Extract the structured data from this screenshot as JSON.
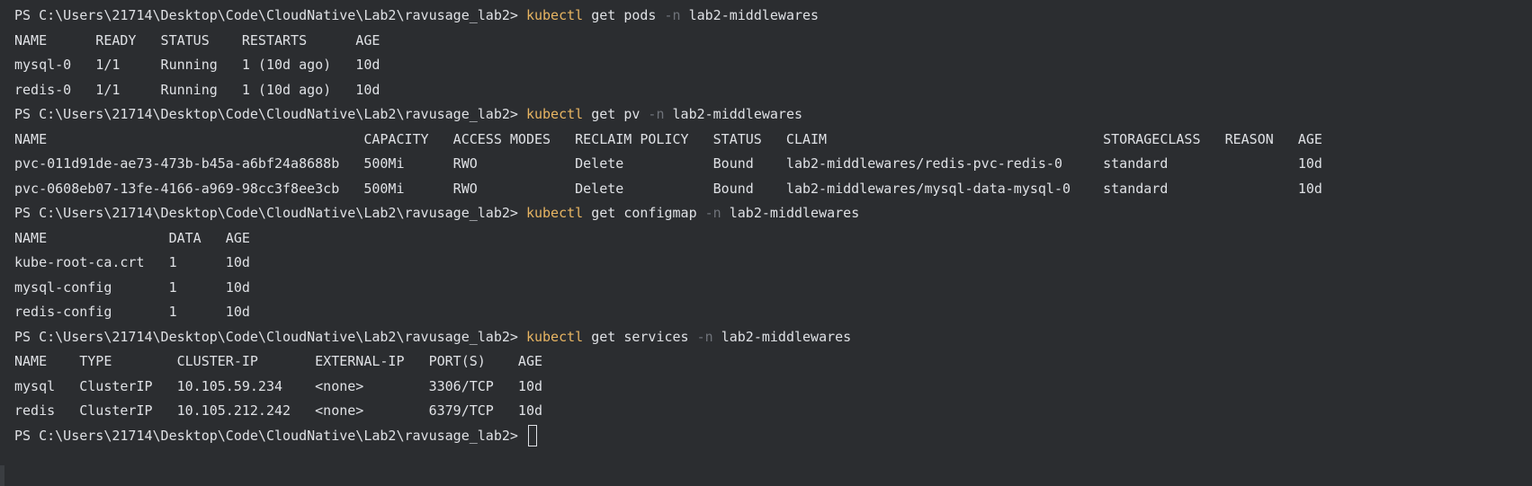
{
  "terminal": {
    "lines": [
      {
        "type": "prompt",
        "prompt": "PS C:\\Users\\21714\\Desktop\\Code\\CloudNative\\Lab2\\ravusage_lab2> ",
        "cmd": "kubectl",
        "args1": " get pods ",
        "flag": "-n",
        "args2": " lab2-middlewares"
      },
      {
        "type": "out",
        "text": "NAME      READY   STATUS    RESTARTS      AGE"
      },
      {
        "type": "out",
        "text": "mysql-0   1/1     Running   1 (10d ago)   10d"
      },
      {
        "type": "out",
        "text": "redis-0   1/1     Running   1 (10d ago)   10d"
      },
      {
        "type": "prompt",
        "prompt": "PS C:\\Users\\21714\\Desktop\\Code\\CloudNative\\Lab2\\ravusage_lab2> ",
        "cmd": "kubectl",
        "args1": " get pv ",
        "flag": "-n",
        "args2": " lab2-middlewares"
      },
      {
        "type": "out",
        "text": "NAME                                       CAPACITY   ACCESS MODES   RECLAIM POLICY   STATUS   CLAIM                                  STORAGECLASS   REASON   AGE"
      },
      {
        "type": "out",
        "text": "pvc-011d91de-ae73-473b-b45a-a6bf24a8688b   500Mi      RWO            Delete           Bound    lab2-middlewares/redis-pvc-redis-0     standard                10d"
      },
      {
        "type": "out",
        "text": "pvc-0608eb07-13fe-4166-a969-98cc3f8ee3cb   500Mi      RWO            Delete           Bound    lab2-middlewares/mysql-data-mysql-0    standard                10d"
      },
      {
        "type": "prompt",
        "prompt": "PS C:\\Users\\21714\\Desktop\\Code\\CloudNative\\Lab2\\ravusage_lab2> ",
        "cmd": "kubectl",
        "args1": " get configmap ",
        "flag": "-n",
        "args2": " lab2-middlewares"
      },
      {
        "type": "out",
        "text": "NAME               DATA   AGE"
      },
      {
        "type": "out",
        "text": "kube-root-ca.crt   1      10d"
      },
      {
        "type": "out",
        "text": "mysql-config       1      10d"
      },
      {
        "type": "out",
        "text": "redis-config       1      10d"
      },
      {
        "type": "prompt",
        "prompt": "PS C:\\Users\\21714\\Desktop\\Code\\CloudNative\\Lab2\\ravusage_lab2> ",
        "cmd": "kubectl",
        "args1": " get services ",
        "flag": "-n",
        "args2": " lab2-middlewares"
      },
      {
        "type": "out",
        "text": "NAME    TYPE        CLUSTER-IP       EXTERNAL-IP   PORT(S)    AGE"
      },
      {
        "type": "out",
        "text": "mysql   ClusterIP   10.105.59.234    <none>        3306/TCP   10d"
      },
      {
        "type": "out",
        "text": "redis   ClusterIP   10.105.212.242   <none>        6379/TCP   10d"
      },
      {
        "type": "prompt_active",
        "prompt": "PS C:\\Users\\21714\\Desktop\\Code\\CloudNative\\Lab2\\ravusage_lab2> "
      }
    ]
  }
}
